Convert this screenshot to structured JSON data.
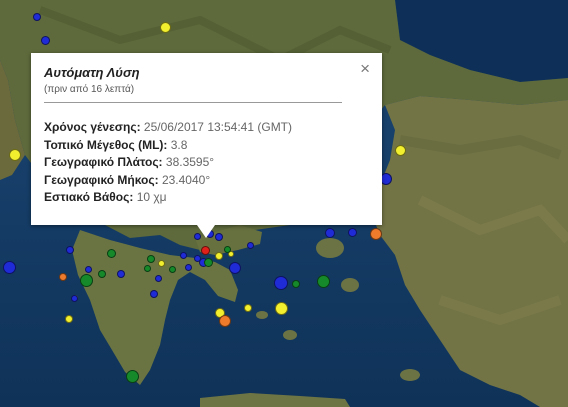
{
  "popup": {
    "title": "Αυτόματη Λύση",
    "subtitle": "(πριν από 16 λεπτά)",
    "close_symbol": "×",
    "rows": [
      {
        "label": "Χρόνος γένεσης:",
        "value": "25/06/2017  13:54:41 (GMT)"
      },
      {
        "label": "Τοπικό Μέγεθος (ML):",
        "value": "3.8"
      },
      {
        "label": "Γεωγραφικό Πλάτος:",
        "value": "38.3595°"
      },
      {
        "label": "Γεωγραφικό Μήκος:",
        "value": "23.4040°"
      },
      {
        "label": "Εστιακό Βάθος:",
        "value": "10 χμ"
      }
    ]
  },
  "colors": {
    "sea": "#163e6b",
    "land": "#5d6a3c",
    "red": "#e0201b",
    "blue": "#1f2bd6",
    "green": "#168a2a",
    "yellow": "#f2ef2e",
    "orange": "#ee7a2c"
  }
}
